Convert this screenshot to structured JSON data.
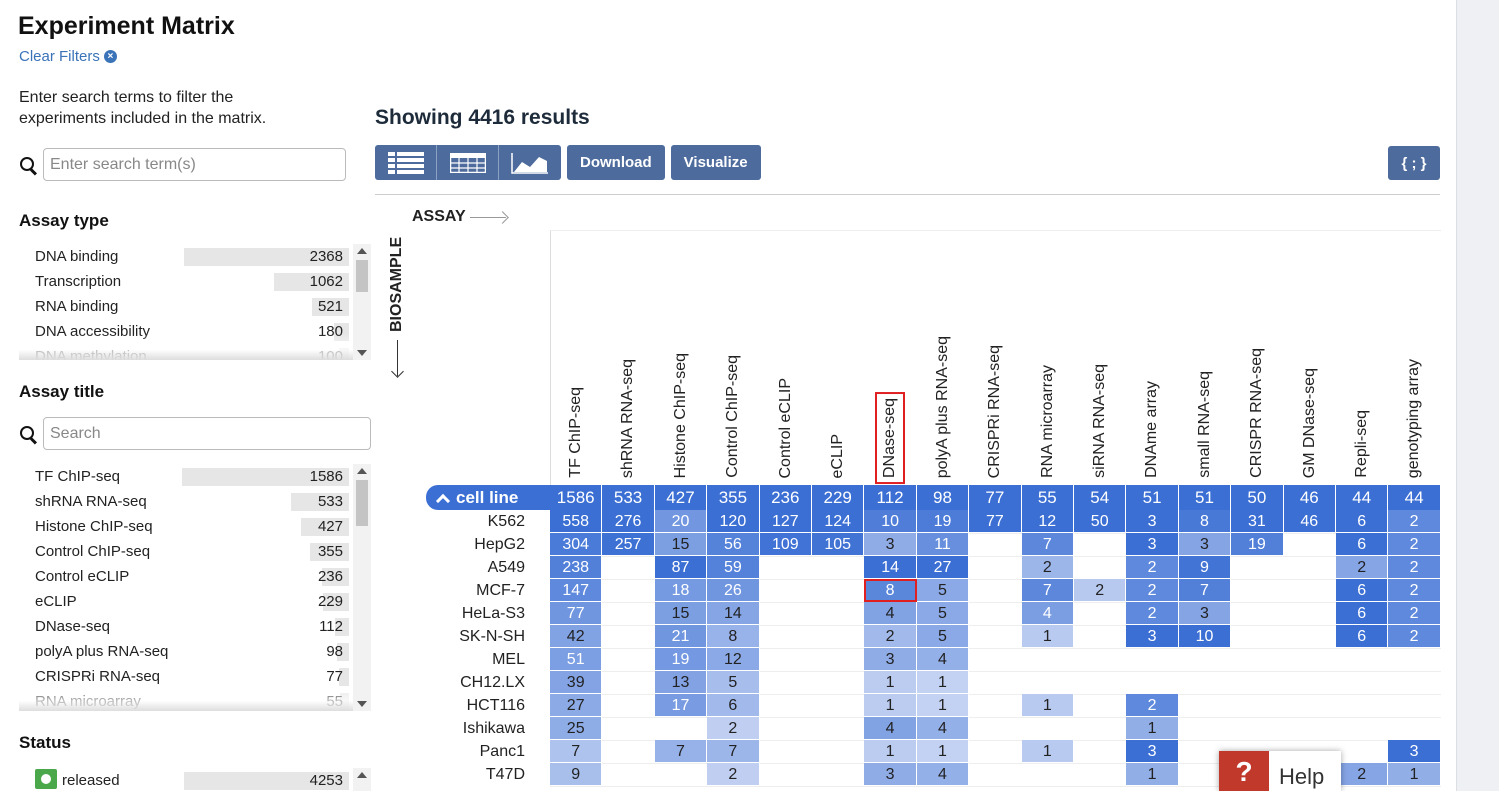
{
  "page": {
    "title": "Experiment Matrix",
    "clear_filters": "Clear Filters",
    "intro": "Enter search terms to filter the experiments included in the matrix.",
    "search_placeholder": "Enter search term(s)"
  },
  "facets": {
    "assay_type": {
      "title": "Assay type",
      "items": [
        {
          "label": "DNA binding",
          "count": "2368",
          "frac": 0.97
        },
        {
          "label": "Transcription",
          "count": "1062",
          "frac": 0.44
        },
        {
          "label": "RNA binding",
          "count": "521",
          "frac": 0.22
        },
        {
          "label": "DNA accessibility",
          "count": "180",
          "frac": 0.09
        },
        {
          "label": "DNA methylation",
          "count": "100",
          "frac": 0.06
        }
      ]
    },
    "assay_title": {
      "title": "Assay title",
      "search_placeholder": "Search",
      "items": [
        {
          "label": "TF ChIP-seq",
          "count": "1586",
          "frac": 0.98
        },
        {
          "label": "shRNA RNA-seq",
          "count": "533",
          "frac": 0.34
        },
        {
          "label": "Histone ChIP-seq",
          "count": "427",
          "frac": 0.28
        },
        {
          "label": "Control ChIP-seq",
          "count": "355",
          "frac": 0.23
        },
        {
          "label": "Control eCLIP",
          "count": "236",
          "frac": 0.16
        },
        {
          "label": "eCLIP",
          "count": "229",
          "frac": 0.15
        },
        {
          "label": "DNase-seq",
          "count": "112",
          "frac": 0.08
        },
        {
          "label": "polyA plus RNA-seq",
          "count": "98",
          "frac": 0.07
        },
        {
          "label": "CRISPRi RNA-seq",
          "count": "77",
          "frac": 0.06
        },
        {
          "label": "RNA microarray",
          "count": "55",
          "frac": 0.05
        }
      ]
    },
    "status": {
      "title": "Status",
      "items": [
        {
          "label": "released",
          "count": "4253",
          "frac": 0.97
        }
      ]
    }
  },
  "results": {
    "title": "Showing 4416 results",
    "download": "Download",
    "visualize": "Visualize",
    "json": "{ ; }"
  },
  "matrix": {
    "x_axis": "ASSAY",
    "y_axis": "BIOSAMPLE",
    "group": "cell line",
    "columns": [
      "TF ChIP-seq",
      "shRNA RNA-seq",
      "Histone ChIP-seq",
      "Control ChIP-seq",
      "Control eCLIP",
      "eCLIP",
      "DNase-seq",
      "polyA plus RNA-seq",
      "CRISPRi RNA-seq",
      "RNA microarray",
      "siRNA RNA-seq",
      "DNAme array",
      "small RNA-seq",
      "CRISPR RNA-seq",
      "GM DNase-seq",
      "Repli-seq",
      "genotyping array"
    ],
    "group_totals": [
      "1586",
      "533",
      "427",
      "355",
      "236",
      "229",
      "112",
      "98",
      "77",
      "55",
      "54",
      "51",
      "51",
      "50",
      "46",
      "44",
      "44"
    ],
    "rows": [
      {
        "label": "K562",
        "values": [
          558,
          276,
          20,
          120,
          127,
          124,
          10,
          19,
          77,
          12,
          50,
          3,
          8,
          31,
          46,
          6,
          2
        ]
      },
      {
        "label": "HepG2",
        "values": [
          304,
          257,
          15,
          56,
          109,
          105,
          3,
          11,
          null,
          7,
          null,
          3,
          3,
          19,
          null,
          6,
          2
        ]
      },
      {
        "label": "A549",
        "values": [
          238,
          null,
          87,
          59,
          null,
          null,
          14,
          27,
          null,
          2,
          null,
          2,
          9,
          null,
          null,
          2,
          2
        ]
      },
      {
        "label": "MCF-7",
        "values": [
          147,
          null,
          18,
          26,
          null,
          null,
          8,
          5,
          null,
          7,
          2,
          2,
          7,
          null,
          null,
          6,
          2
        ]
      },
      {
        "label": "HeLa-S3",
        "values": [
          77,
          null,
          15,
          14,
          null,
          null,
          4,
          5,
          null,
          4,
          null,
          2,
          3,
          null,
          null,
          6,
          2
        ]
      },
      {
        "label": "SK-N-SH",
        "values": [
          42,
          null,
          21,
          8,
          null,
          null,
          2,
          5,
          null,
          1,
          null,
          3,
          10,
          null,
          null,
          6,
          2
        ]
      },
      {
        "label": "MEL",
        "values": [
          51,
          null,
          19,
          12,
          null,
          null,
          3,
          4,
          null,
          null,
          null,
          null,
          null,
          null,
          null,
          null,
          null
        ]
      },
      {
        "label": "CH12.LX",
        "values": [
          39,
          null,
          13,
          5,
          null,
          null,
          1,
          1,
          null,
          null,
          null,
          null,
          null,
          null,
          null,
          null,
          null
        ]
      },
      {
        "label": "HCT116",
        "values": [
          27,
          null,
          17,
          6,
          null,
          null,
          1,
          1,
          null,
          1,
          null,
          2,
          null,
          null,
          null,
          null,
          null
        ]
      },
      {
        "label": "Ishikawa",
        "values": [
          25,
          null,
          null,
          2,
          null,
          null,
          4,
          4,
          null,
          null,
          null,
          1,
          null,
          null,
          null,
          null,
          null
        ]
      },
      {
        "label": "Panc1",
        "values": [
          7,
          null,
          7,
          7,
          null,
          null,
          1,
          1,
          null,
          1,
          null,
          3,
          null,
          null,
          null,
          null,
          3
        ]
      },
      {
        "label": "T47D",
        "values": [
          9,
          null,
          null,
          2,
          null,
          null,
          3,
          4,
          null,
          null,
          null,
          1,
          null,
          null,
          null,
          2,
          1
        ]
      }
    ],
    "highlight_column": 6,
    "highlight_row": 3
  },
  "help": {
    "icon": "?",
    "label": "Help"
  }
}
